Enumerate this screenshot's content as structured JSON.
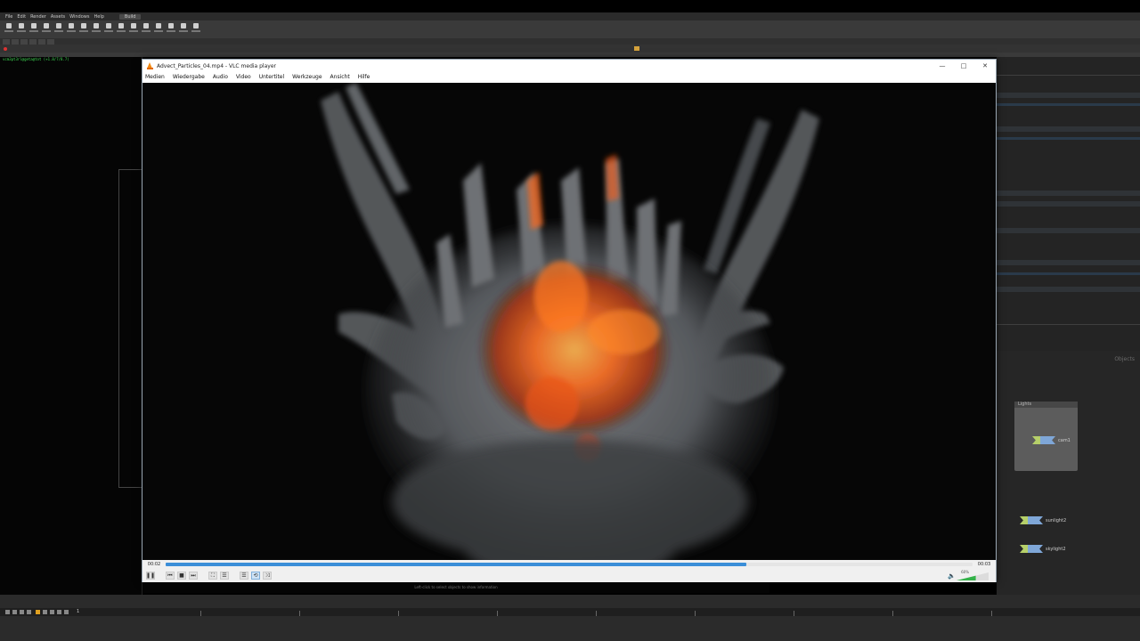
{
  "host": {
    "menu": [
      "File",
      "Edit",
      "Render",
      "Assets",
      "Windows",
      "Help"
    ],
    "desktop": "Build",
    "console_lines": [
      "vcm3pt3rl@geta@tot (+1.8/7/8.7)"
    ],
    "net_context": "Objects",
    "network_box": "Lights",
    "nodes": [
      {
        "name": "cam1"
      },
      {
        "name": "sunlight2"
      },
      {
        "name": "skylight2"
      }
    ],
    "frame_field": "1",
    "status": "Left-click to select objects to show information"
  },
  "vlc": {
    "title": "Advect_Particles_04.mp4 - VLC media player",
    "window_controls": {
      "minimize": "—",
      "maximize": "□",
      "close": "✕"
    },
    "menu": [
      "Medien",
      "Wiedergabe",
      "Audio",
      "Video",
      "Untertitel",
      "Werkzeuge",
      "Ansicht",
      "Hilfe"
    ],
    "time_elapsed": "00:02",
    "time_total": "00:03",
    "progress": 0.72,
    "volume_label": "60%",
    "volume": 0.6,
    "icons": {
      "pause": "❚❚",
      "prev": "⏮",
      "stop": "■",
      "next": "⏭",
      "fullscreen": "⛶",
      "playlist": "☰",
      "loop": "⟲",
      "shuffle": "⤨",
      "speaker": "🔈"
    }
  }
}
